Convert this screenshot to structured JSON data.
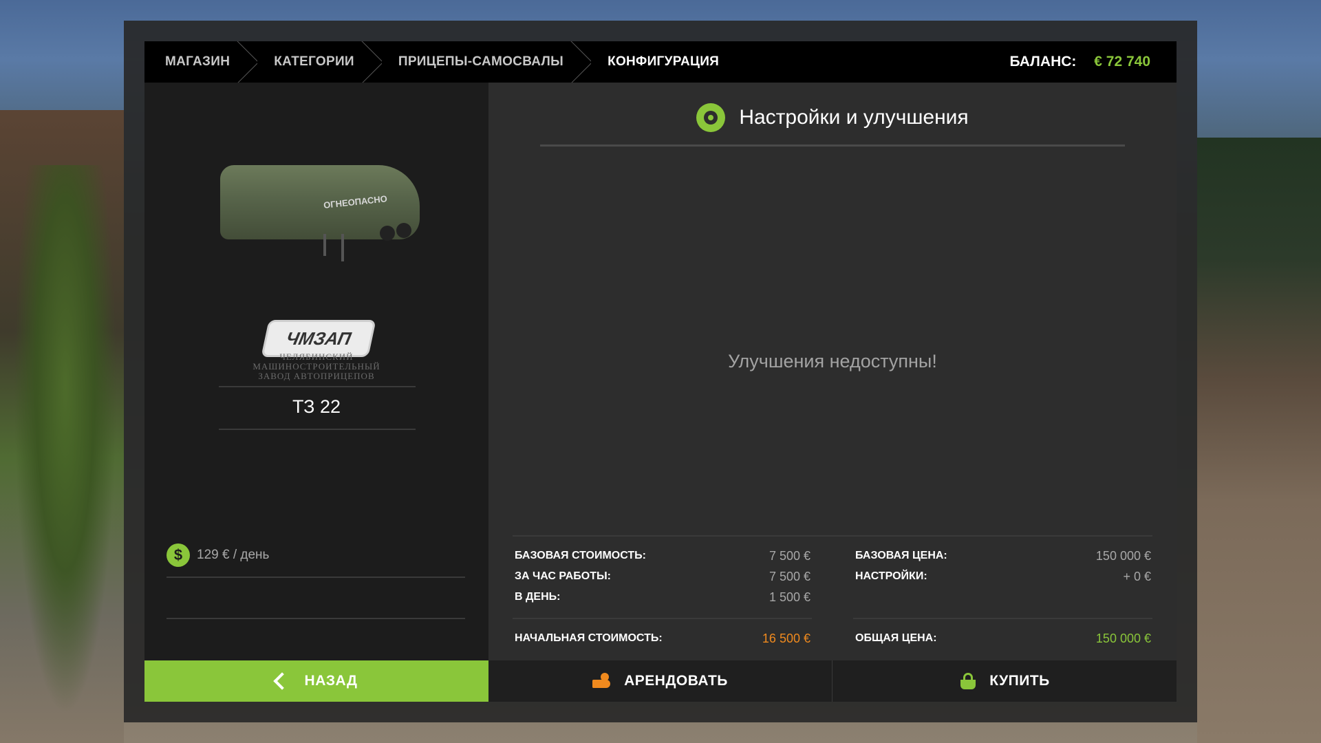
{
  "breadcrumb": {
    "items": [
      "МАГАЗИН",
      "КАТЕГОРИИ",
      "ПРИЦЕПЫ-САМОСВАЛЫ",
      "КОНФИГУРАЦИЯ"
    ],
    "active_index": 3
  },
  "balance": {
    "label": "БАЛАНС:",
    "value": "€ 72 740"
  },
  "vehicle": {
    "tank_text": "ОГНЕОПАСНО",
    "brand_logo": "ЧМЗАП",
    "brand_subtitle_lines": [
      "ЧЕЛЯБИНСКИЙ",
      "МАШИНОСТРОИТЕЛЬНЫЙ",
      "ЗАВОД АВТОПРИЦЕПОВ"
    ],
    "name": "ТЗ 22",
    "daily_cost": "129 € / день"
  },
  "settings": {
    "title": "Настройки и улучшения",
    "empty_message": "Улучшения недоступны!"
  },
  "costs_left": [
    {
      "label": "БАЗОВАЯ СТОИМОСТЬ:",
      "value": "7 500 €"
    },
    {
      "label": "ЗА ЧАС РАБОТЫ:",
      "value": "7 500 €"
    },
    {
      "label": "В ДЕНЬ:",
      "value": "1 500 €"
    }
  ],
  "total_left": {
    "label": "НАЧАЛЬНАЯ СТОИМОСТЬ:",
    "value": "16 500 €"
  },
  "costs_right": [
    {
      "label": "БАЗОВАЯ ЦЕНА:",
      "value": "150 000 €"
    },
    {
      "label": "НАСТРОЙКИ:",
      "value": "+ 0 €"
    }
  ],
  "total_right": {
    "label": "ОБЩАЯ ЦЕНА:",
    "value": "150 000 €"
  },
  "buttons": {
    "back": "НАЗАД",
    "rent": "АРЕНДОВАТЬ",
    "buy": "КУПИТЬ"
  },
  "colors": {
    "accent_green": "#8ac63a",
    "accent_orange": "#f08a1e"
  },
  "icons": {
    "settings": "gear-wrench-icon",
    "daily": "dollar-icon",
    "back": "chevron-left-icon",
    "rent": "hand-coin-icon",
    "buy": "basket-icon"
  }
}
